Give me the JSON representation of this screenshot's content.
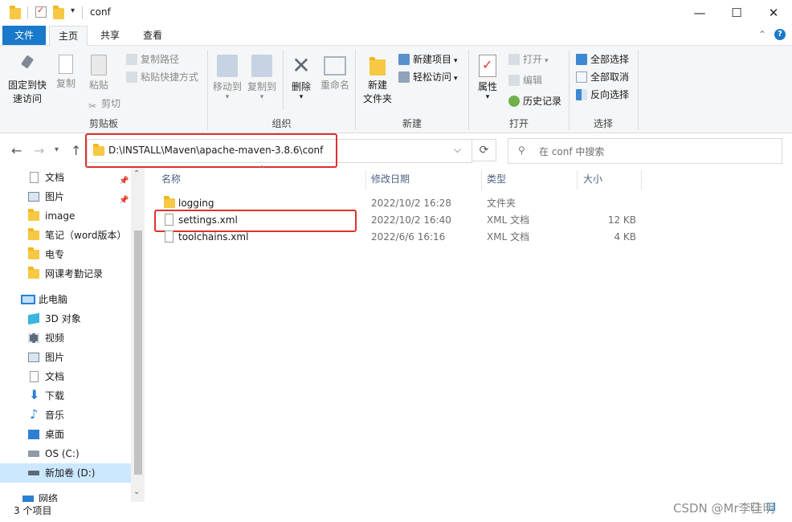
{
  "window": {
    "title": "conf",
    "minimize_glyph": "—",
    "maximize_glyph": "☐",
    "close_glyph": "✕"
  },
  "ribbon_tabs": [
    "文件",
    "主页",
    "共享",
    "查看"
  ],
  "ribbon": {
    "clipboard": {
      "pin": "固定到快\n速访问",
      "pin_l1": "固定到快",
      "pin_l2": "速访问",
      "copy": "复制",
      "paste": "粘贴",
      "copy_path": "复制路径",
      "paste_shortcut": "粘贴快捷方式",
      "cut": "剪切",
      "label": "剪贴板"
    },
    "organize": {
      "move_to": "移动到",
      "copy_to": "复制到",
      "delete": "删除",
      "rename": "重命名",
      "label": "组织"
    },
    "new": {
      "new_folder_l1": "新建",
      "new_folder_l2": "文件夹",
      "new_item": "新建项目",
      "easy_access": "轻松访问",
      "label": "新建"
    },
    "open": {
      "properties": "属性",
      "open": "打开",
      "edit": "编辑",
      "history": "历史记录",
      "label": "打开"
    },
    "select": {
      "select_all": "全部选择",
      "select_none": "全部取消",
      "invert": "反向选择",
      "label": "选择"
    }
  },
  "address": {
    "path": "D:\\INSTALL\\Maven\\apache-maven-3.8.6\\conf",
    "search_placeholder": "在 conf 中搜索"
  },
  "nav": {
    "quick": [
      {
        "label": "文档",
        "pinned": true
      },
      {
        "label": "图片",
        "pinned": true
      },
      {
        "label": "image"
      },
      {
        "label": "笔记（word版本）"
      },
      {
        "label": "电专"
      },
      {
        "label": "网课考勤记录"
      }
    ],
    "this_pc": "此电脑",
    "pc_items": [
      "3D 对象",
      "视频",
      "图片",
      "文档",
      "下载",
      "音乐",
      "桌面",
      "OS (C:)",
      "新加卷 (D:)"
    ],
    "network": "网络"
  },
  "columns": {
    "name": "名称",
    "modified": "修改日期",
    "type": "类型",
    "size": "大小"
  },
  "files": [
    {
      "name": "logging",
      "modified": "2022/10/2 16:28",
      "type": "文件夹",
      "size": ""
    },
    {
      "name": "settings.xml",
      "modified": "2022/10/2 16:40",
      "type": "XML 文档",
      "size": "12 KB"
    },
    {
      "name": "toolchains.xml",
      "modified": "2022/6/6 16:16",
      "type": "XML 文档",
      "size": "4 KB"
    }
  ],
  "status": {
    "count": "3 个项目"
  },
  "watermark": "CSDN @Mr李佳明",
  "colors": {
    "accent": "#1979ca",
    "highlight": "#e0312d",
    "folder": "#f7c844"
  }
}
